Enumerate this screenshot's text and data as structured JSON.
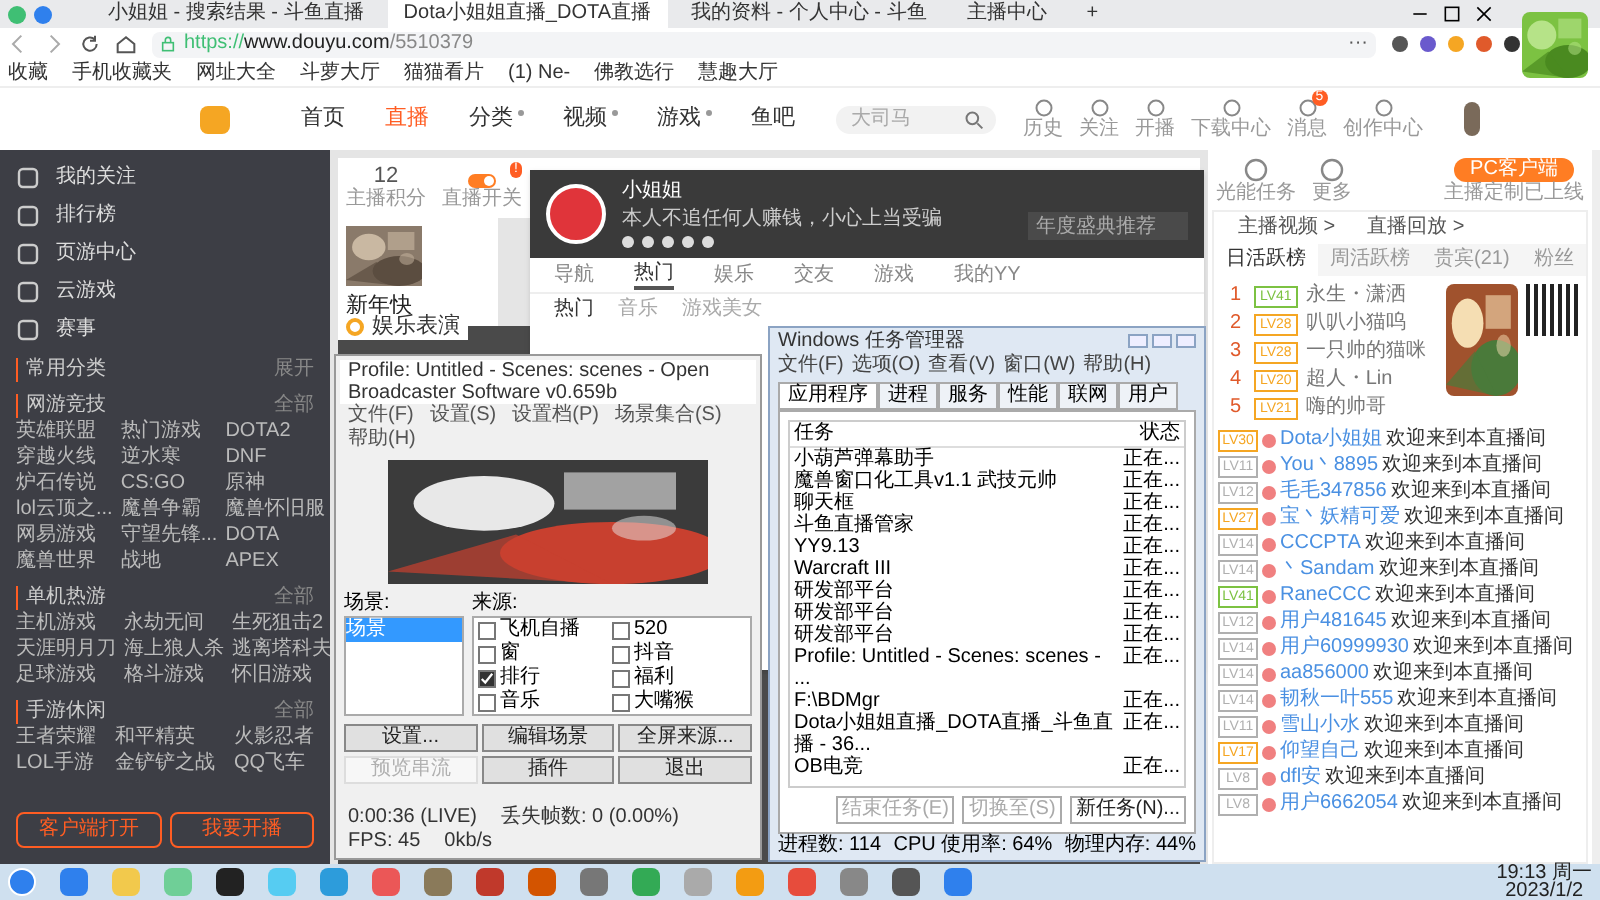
{
  "browser": {
    "tabs": [
      {
        "label": "小姐姐 - 搜索结果 - 斗鱼直播",
        "selected": false
      },
      {
        "label": "Dota小姐姐直播_DOTA直播",
        "selected": true
      },
      {
        "label": "我的资料 - 个人中心 - 斗鱼",
        "selected": false
      },
      {
        "label": "主播中心",
        "selected": false
      }
    ],
    "new_tab": "+",
    "url_scheme": "https://",
    "url_host": "www.douyu.com",
    "url_path": "/5510379",
    "more": "···",
    "bookmarks": [
      "收藏",
      "手机收藏夹",
      "网址大全",
      "斗萝大厅",
      "猫猫看片",
      "(1) Ne-",
      "佛教选行",
      "慧趣大厅"
    ]
  },
  "site": {
    "nav": [
      {
        "label": "首页",
        "selected": false,
        "dropdown": false
      },
      {
        "label": "直播",
        "selected": true,
        "dropdown": false
      },
      {
        "label": "分类",
        "selected": false,
        "dropdown": true
      },
      {
        "label": "视频",
        "selected": false,
        "dropdown": true
      },
      {
        "label": "游戏",
        "selected": false,
        "dropdown": true
      },
      {
        "label": "鱼吧",
        "selected": false,
        "dropdown": false
      }
    ],
    "search": {
      "placeholder": "大司马"
    },
    "header_links": [
      {
        "label": "历史"
      },
      {
        "label": "关注"
      },
      {
        "label": "开播"
      },
      {
        "label": "下载中心"
      },
      {
        "label": "消息",
        "badge": "5"
      },
      {
        "label": "创作中心"
      }
    ]
  },
  "sidebar": {
    "items": [
      "我的关注",
      "排行榜",
      "页游中心",
      "云游戏",
      "赛事"
    ],
    "common": {
      "title": "常用分类",
      "action": "展开"
    },
    "sections": [
      {
        "title": "网游竞技",
        "action": "全部",
        "items": [
          "英雄联盟",
          "热门游戏",
          "DOTA2",
          "穿越火线",
          "逆水寒",
          "DNF",
          "炉石传说",
          "CS:GO",
          "原神",
          "lol云顶之...",
          "魔兽争霸",
          "魔兽怀旧服",
          "网易游戏",
          "守望先锋...",
          "DOTA",
          "魔兽世界",
          "战地",
          "APEX"
        ]
      },
      {
        "title": "单机热游",
        "action": "全部",
        "items": [
          "主机游戏",
          "永劫无间",
          "生死狙击2",
          "天涯明月刀",
          "海上狼人杀",
          "逃离塔科夫",
          "足球游戏",
          "格斗游戏",
          "怀旧游戏"
        ]
      },
      {
        "title": "手游休闲",
        "action": "全部",
        "items": [
          "王者荣耀",
          "和平精英",
          "火影忍者",
          "LOL手游",
          "金铲铲之战",
          "QQ飞车"
        ]
      }
    ],
    "buttons": [
      "客户端打开",
      "我要开播"
    ]
  },
  "streamer": {
    "score": "12",
    "score_label": "主播积分",
    "switch_label": "直播开关",
    "switch_on": true,
    "switch_badge": "!",
    "title": "新年快",
    "tools": [
      "光能任务",
      "更多"
    ],
    "pc_button": "PC客户端",
    "pc_note": "主播定制已上线"
  },
  "yy": {
    "name": "小姐姐",
    "signature": "本人不追任何人赚钱，小心上当受骗",
    "search": {
      "placeholder": "年度盛典推荐"
    },
    "tabs": [
      {
        "label": "导航",
        "selected": false
      },
      {
        "label": "热门",
        "selected": true
      },
      {
        "label": "娱乐",
        "selected": false
      },
      {
        "label": "交友",
        "selected": false
      },
      {
        "label": "游戏",
        "selected": false
      },
      {
        "label": "我的YY",
        "selected": false
      }
    ],
    "subtabs": [
      {
        "label": "热门",
        "selected": true
      },
      {
        "label": "音乐",
        "selected": false
      },
      {
        "label": "游戏美女",
        "selected": false
      }
    ],
    "section_title": "娱乐表演"
  },
  "obs": {
    "title": "Profile: Untitled - Scenes: scenes - Open Broadcaster Software v0.659b",
    "menu": [
      "文件(F)",
      "设置(S)",
      "设置档(P)",
      "场景集合(S)",
      "帮助(H)"
    ],
    "scenes_label": "场景:",
    "scenes": [
      {
        "label": "场景",
        "selected": true
      }
    ],
    "sources_label": "来源:",
    "sources": [
      {
        "label": "飞机自播",
        "checked": false
      },
      {
        "label": "520",
        "checked": false
      },
      {
        "label": "窗",
        "checked": false
      },
      {
        "label": "抖音",
        "checked": false
      },
      {
        "label": "排行",
        "checked": true
      },
      {
        "label": "福利",
        "checked": false
      },
      {
        "label": "音乐",
        "checked": false
      },
      {
        "label": "大嘴猴",
        "checked": false
      }
    ],
    "buttons": [
      {
        "label": "设置...",
        "disabled": false
      },
      {
        "label": "编辑场景",
        "disabled": false
      },
      {
        "label": "全屏来源...",
        "disabled": false
      },
      {
        "label": "预览串流",
        "disabled": true
      },
      {
        "label": "插件",
        "disabled": false
      },
      {
        "label": "退出",
        "disabled": false
      }
    ],
    "status": [
      "0:00:36 (LIVE)",
      "丢失帧数: 0 (0.00%)",
      "FPS: 45",
      "0kb/s"
    ]
  },
  "task_manager": {
    "title": "Windows 任务管理器",
    "menu": [
      "文件(F)",
      "选项(O)",
      "查看(V)",
      "窗口(W)",
      "帮助(H)"
    ],
    "tabs": [
      {
        "label": "应用程序",
        "selected": true
      },
      {
        "label": "进程",
        "selected": false
      },
      {
        "label": "服务",
        "selected": false
      },
      {
        "label": "性能",
        "selected": false
      },
      {
        "label": "联网",
        "selected": false
      },
      {
        "label": "用户",
        "selected": false
      }
    ],
    "columns": [
      "任务",
      "状态"
    ],
    "rows": [
      {
        "task": "小葫芦弹幕助手",
        "status": "正在..."
      },
      {
        "task": "魔兽窗口化工具v1.1 武技元帅",
        "status": "正在..."
      },
      {
        "task": "聊天框",
        "status": "正在..."
      },
      {
        "task": "斗鱼直播管家",
        "status": "正在..."
      },
      {
        "task": "YY9.13",
        "status": "正在..."
      },
      {
        "task": "Warcraft III",
        "status": "正在..."
      },
      {
        "task": "研发部平台",
        "status": "正在..."
      },
      {
        "task": "研发部平台",
        "status": "正在..."
      },
      {
        "task": "研发部平台",
        "status": "正在..."
      },
      {
        "task": "Profile: Untitled - Scenes: scenes - ...",
        "status": "正在..."
      },
      {
        "task": "F:\\BDMgr",
        "status": "正在..."
      },
      {
        "task": "Dota小姐姐直播_DOTA直播_斗鱼直播 - 36...",
        "status": "正在..."
      },
      {
        "task": "OB电竞",
        "status": "正在..."
      }
    ],
    "buttons": [
      "结束任务(E)",
      "切换至(S)",
      "新任务(N)..."
    ],
    "status": [
      "进程数: 114",
      "CPU 使用率: 64%",
      "物理内存: 44%"
    ]
  },
  "side_panel": {
    "links": [
      "主播视频 >",
      "直播回放 >"
    ],
    "tabs": [
      {
        "label": "日活跃榜",
        "selected": true
      },
      {
        "label": "周活跃榜",
        "selected": false
      },
      {
        "label": "贵宾(21)",
        "selected": false
      },
      {
        "label": "粉丝",
        "selected": false
      }
    ],
    "ranking": [
      {
        "rank": "1",
        "level": "LV41",
        "name": "永生・潇洒",
        "color": "#7cc242"
      },
      {
        "rank": "2",
        "level": "LV28",
        "name": "叭叭小猫呜",
        "color": "#f5a623"
      },
      {
        "rank": "3",
        "level": "LV28",
        "name": "一只帅的猫咪",
        "color": "#f5a623"
      },
      {
        "rank": "4",
        "level": "LV20",
        "name": "超人・Lin",
        "color": "#f5a623"
      },
      {
        "rank": "5",
        "level": "LV21",
        "name": "嗨的帅哥",
        "color": "#f5a623"
      }
    ],
    "chat": [
      {
        "level": "LV30",
        "name": "Dota小姐姐",
        "message": "欢迎来到本直播间",
        "color": "#f5a623"
      },
      {
        "level": "LV11",
        "name": "You丶8895",
        "message": "欢迎来到本直播间",
        "color": "#b0b0b0"
      },
      {
        "level": "LV12",
        "name": "毛毛347856",
        "message": "欢迎来到本直播间",
        "color": "#b0b0b0"
      },
      {
        "level": "LV27",
        "name": "宝丶妖精可爱",
        "message": "欢迎来到本直播间",
        "color": "#f5a623"
      },
      {
        "level": "LV14",
        "name": "CCCPTA",
        "message": "欢迎来到本直播间",
        "color": "#b0b0b0"
      },
      {
        "level": "LV14",
        "name": "丶Sandam",
        "message": "欢迎来到本直播间",
        "color": "#b0b0b0"
      },
      {
        "level": "LV41",
        "name": "RaneCCC",
        "message": "欢迎来到本直播间",
        "color": "#7cc242"
      },
      {
        "level": "LV12",
        "name": "用户481645",
        "message": "欢迎来到本直播间",
        "color": "#b0b0b0"
      },
      {
        "level": "LV14",
        "name": "用户60999930",
        "message": "欢迎来到本直播间",
        "color": "#b0b0b0"
      },
      {
        "level": "LV14",
        "name": "aa856000",
        "message": "欢迎来到本直播间",
        "color": "#b0b0b0"
      },
      {
        "level": "LV14",
        "name": "韧秋一叶555",
        "message": "欢迎来到本直播间",
        "color": "#b0b0b0"
      },
      {
        "level": "LV11",
        "name": "雪山小水",
        "message": "欢迎来到本直播间",
        "color": "#b0b0b0"
      },
      {
        "level": "LV17",
        "name": "仰望自己",
        "message": "欢迎来到本直播间",
        "color": "#f5a623"
      },
      {
        "level": "LV8",
        "name": "dfl安",
        "message": "欢迎来到本直播间",
        "color": "#b0b0b0"
      },
      {
        "level": "LV8",
        "name": "用户6662054",
        "message": "欢迎来到本直播间",
        "color": "#b0b0b0"
      }
    ]
  },
  "taskbar": {
    "time": "19:13 周一",
    "date": "2023/1/2"
  }
}
